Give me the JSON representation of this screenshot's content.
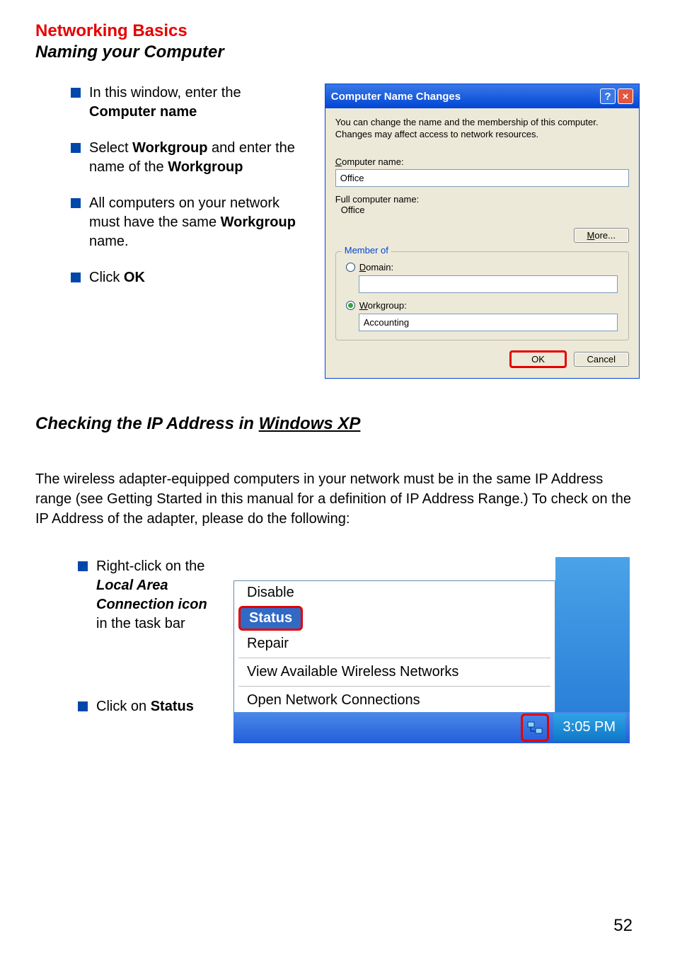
{
  "header": {
    "title_red": "Networking Basics",
    "subtitle_italic": "Naming your Computer"
  },
  "bullets_top": {
    "b1_pre": "In this window, enter the ",
    "b1_bold": "Computer name",
    "b2_pre": "Select ",
    "b2_bold1": "Workgroup",
    "b2_mid": " and enter the name of the ",
    "b2_bold2": "Workgroup",
    "b3_pre": "All computers on your network must have the same ",
    "b3_bold": "Workgroup",
    "b3_post": " name.",
    "b4_pre": "Click ",
    "b4_bold": "OK"
  },
  "dialog": {
    "title": "Computer Name Changes",
    "desc": "You can change the name and the membership of this computer. Changes may affect access to network resources.",
    "comp_label": "Computer name:",
    "comp_value": "Office",
    "full_label": "Full computer name:",
    "full_value": "Office",
    "more": "More...",
    "member_legend": "Member of",
    "domain_label": "Domain:",
    "domain_value": "",
    "workgroup_label": "Workgroup:",
    "workgroup_value": "Accounting",
    "ok": "OK",
    "cancel": "Cancel"
  },
  "section2": {
    "heading_pre": "Checking the IP Address in ",
    "heading_u": "Windows XP",
    "body": "The wireless adapter-equipped computers in your network must be in the same IP Address range (see Getting Started in this manual for a definition of IP Address Range.)  To check on the IP Address of the adapter, please do the following:"
  },
  "bullets_bottom": {
    "b1_pre": "Right-click on the ",
    "b1_bold": "Local Area Connection icon",
    "b1_post": " in the task bar",
    "b2_pre": "Click on ",
    "b2_bold": "Status"
  },
  "context_menu": {
    "disable": "Disable",
    "status": "Status",
    "repair": "Repair",
    "view_wireless": "View Available Wireless Networks",
    "open_conn": "Open Network Connections"
  },
  "taskbar": {
    "clock": "3:05 PM"
  },
  "page_number": "52"
}
